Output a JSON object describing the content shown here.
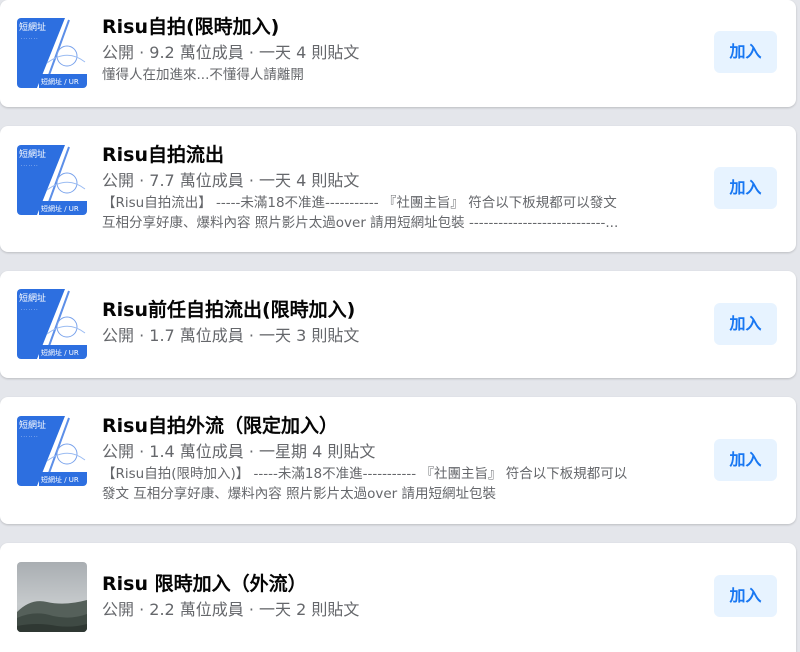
{
  "groups": [
    {
      "title": "Risu自拍(限時加入)",
      "meta": "公開 · 9.2 萬位成員 · 一天 4 則貼文",
      "description": "懂得人在加進來...不懂得人請離開",
      "join_label": "加入",
      "thumb_text_top": "短網址",
      "thumb_text_bottom": "短網址 / UR"
    },
    {
      "title": "Risu自拍流出",
      "meta": "公開 · 7.7 萬位成員 · 一天 4 則貼文",
      "description": "【Risu自拍流出】 -----未滿18不准進----------- 『社團主旨』 符合以下板規都可以發文\n互相分享好康、爆料內容 照片影片太過over 請用短網址包裝 ----------------------------...",
      "join_label": "加入",
      "thumb_text_top": "短網址",
      "thumb_text_bottom": "短網址 / UR"
    },
    {
      "title": "Risu前任自拍流出(限時加入)",
      "meta": "公開 · 1.7 萬位成員 · 一天 3 則貼文",
      "description": "",
      "join_label": "加入",
      "thumb_text_top": "短網址",
      "thumb_text_bottom": "短網址 / UR"
    },
    {
      "title": "Risu自拍外流（限定加入）",
      "meta": "公開 · 1.4 萬位成員 · 一星期 4 則貼文",
      "description": "【Risu自拍(限時加入)】 -----未滿18不准進----------- 『社團主旨』 符合以下板規都可以\n發文 互相分享好康、爆料內容 照片影片太過over 請用短網址包裝",
      "join_label": "加入",
      "thumb_text_top": "短網址",
      "thumb_text_bottom": "短網址 / UR"
    },
    {
      "title": "Risu 限時加入（外流）",
      "meta": "公開 · 2.2 萬位成員 · 一天 2 則貼文",
      "description": "",
      "join_label": "加入"
    }
  ],
  "colors": {
    "accent": "#1877f2",
    "join_bg": "#e7f3ff",
    "secondary_text": "#65676b",
    "page_bg": "#e4e6eb"
  }
}
